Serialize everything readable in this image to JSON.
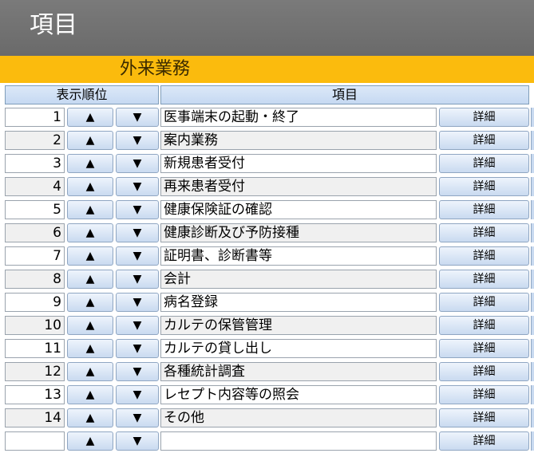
{
  "header": {
    "title": "項目"
  },
  "section": {
    "label": "外来業務"
  },
  "columns": {
    "order": "表示順位",
    "item": "項目"
  },
  "buttons": {
    "up": "▲",
    "down": "▼",
    "detail": "詳細"
  },
  "rows": [
    {
      "order": "1",
      "item": "医事端末の起動・終了"
    },
    {
      "order": "2",
      "item": "案内業務"
    },
    {
      "order": "3",
      "item": "新規患者受付"
    },
    {
      "order": "4",
      "item": "再来患者受付"
    },
    {
      "order": "5",
      "item": "健康保険証の確認"
    },
    {
      "order": "6",
      "item": "健康診断及び予防接種"
    },
    {
      "order": "7",
      "item": "証明書、診断書等"
    },
    {
      "order": "8",
      "item": "会計"
    },
    {
      "order": "9",
      "item": "病名登録"
    },
    {
      "order": "10",
      "item": "カルテの保管管理"
    },
    {
      "order": "11",
      "item": "カルテの貸し出し"
    },
    {
      "order": "12",
      "item": "各種統計調査"
    },
    {
      "order": "13",
      "item": "レセプト内容等の照会"
    },
    {
      "order": "14",
      "item": "その他"
    },
    {
      "order": "",
      "item": ""
    }
  ]
}
